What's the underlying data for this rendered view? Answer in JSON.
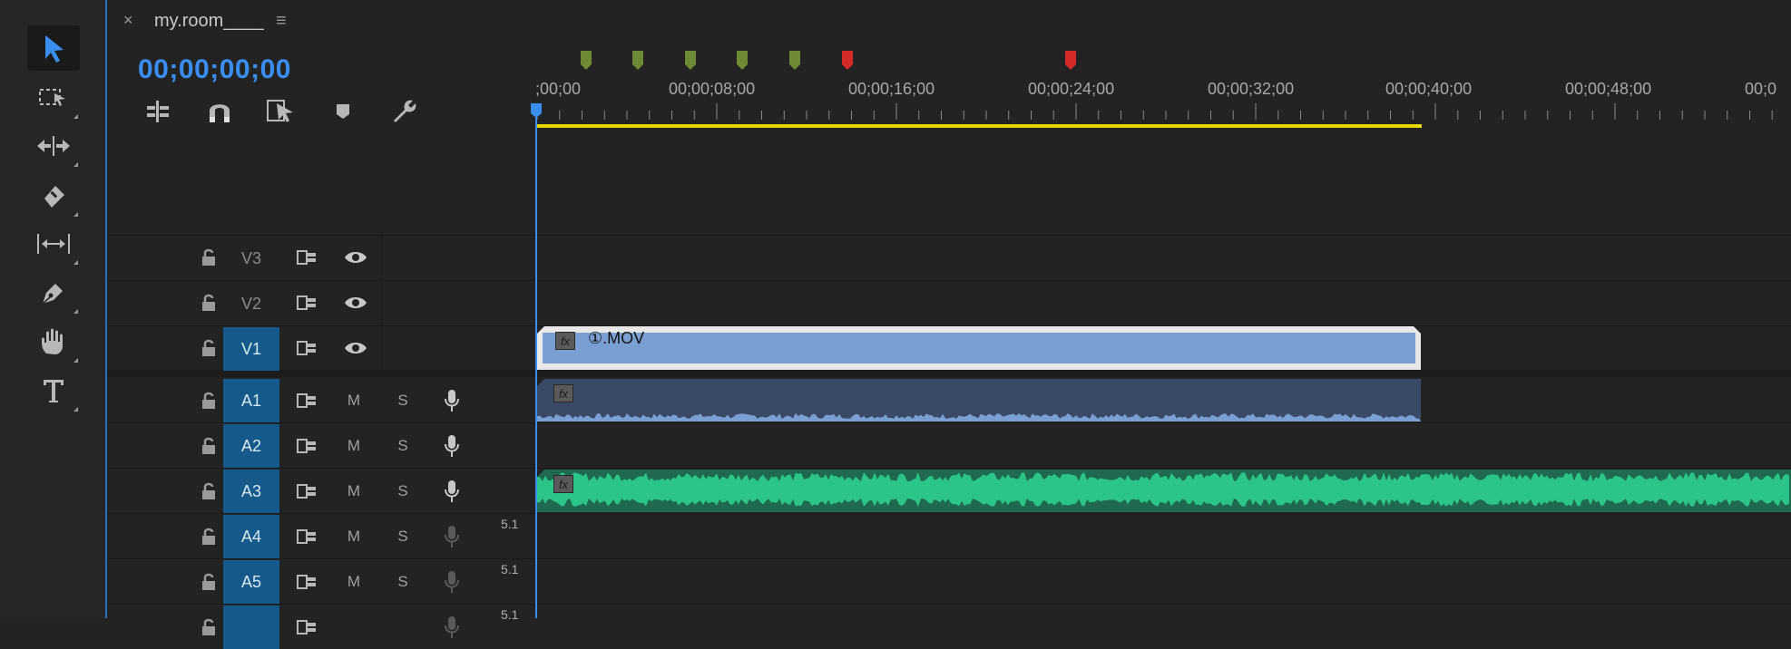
{
  "tab": {
    "close": "×",
    "title": "my.room____",
    "menu": "≡"
  },
  "timecode": "00;00;00;00",
  "ruler": {
    "labels": [
      ";00;00",
      "00;00;08;00",
      "00;00;16;00",
      "00;00;24;00",
      "00;00;32;00",
      "00;00;40;00",
      "00;00;48;00",
      "00;0"
    ],
    "markers": [
      "green",
      "green",
      "green",
      "green",
      "green",
      "red",
      "red"
    ]
  },
  "tracks": {
    "video": [
      {
        "name": "V3",
        "active": false
      },
      {
        "name": "V2",
        "active": false
      },
      {
        "name": "V1",
        "active": true
      }
    ],
    "audio": [
      {
        "name": "A1",
        "m": "M",
        "s": "S",
        "chan": ""
      },
      {
        "name": "A2",
        "m": "M",
        "s": "S",
        "chan": ""
      },
      {
        "name": "A3",
        "m": "M",
        "s": "S",
        "chan": ""
      },
      {
        "name": "A4",
        "m": "M",
        "s": "S",
        "chan": "5.1"
      },
      {
        "name": "A5",
        "m": "M",
        "s": "S",
        "chan": "5.1"
      },
      {
        "name": "",
        "m": "",
        "s": "",
        "chan": "5.1"
      }
    ]
  },
  "clips": {
    "v1_label": "①.MOV",
    "fx": "fx"
  },
  "colors": {
    "accent": "#3a8ef0",
    "track_on": "#155a8a",
    "video_clip": "#7a9fd3",
    "audio_clip_bg": "#3a4a66",
    "audio_green": "#2bc58a",
    "in_out": "#e8d800",
    "marker_green": "#6f8a34",
    "marker_red": "#d42a2a"
  }
}
